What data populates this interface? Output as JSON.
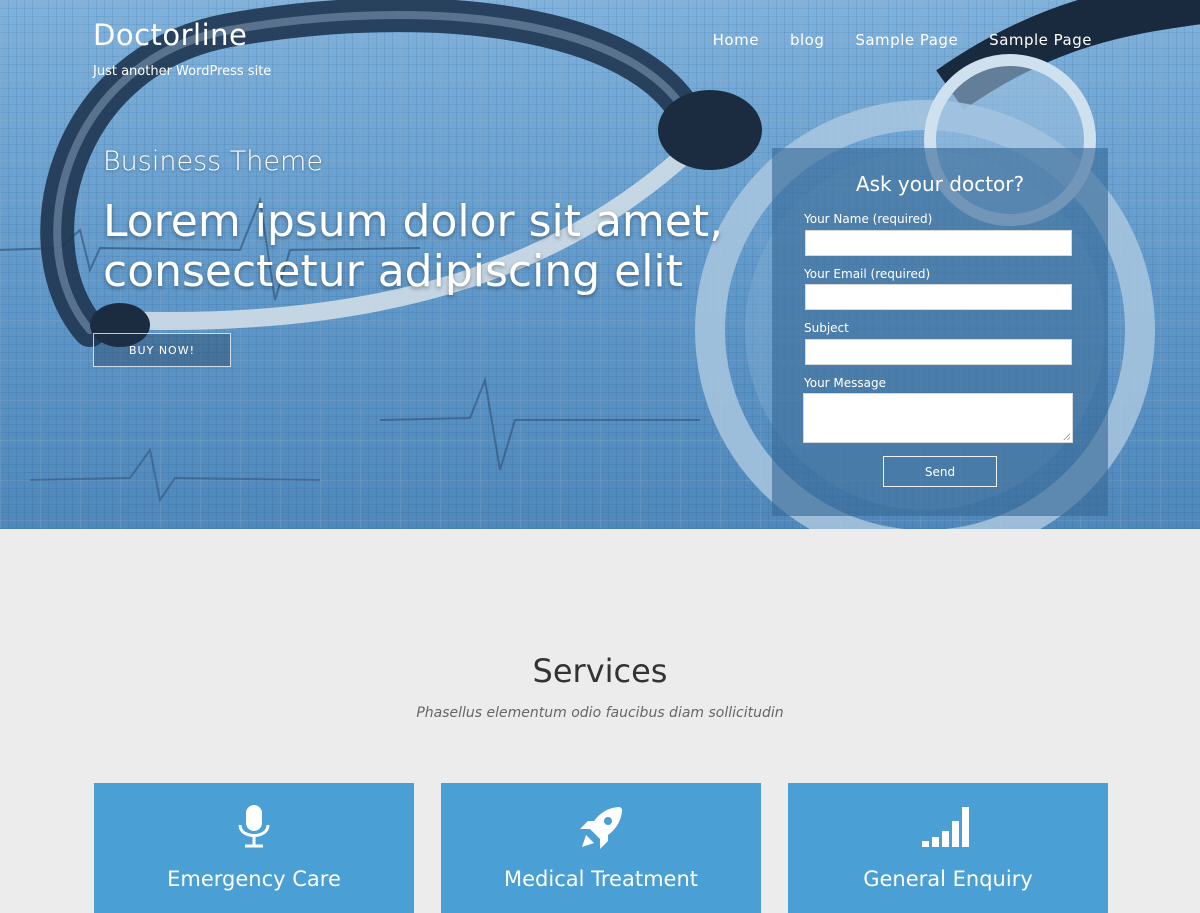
{
  "header": {
    "site_title": "Doctorline",
    "tagline": "Just another WordPress site",
    "nav": [
      "Home",
      "blog",
      "Sample Page",
      "Sample Page"
    ]
  },
  "hero": {
    "eyebrow": "Business Theme",
    "headline": "Lorem ipsum dolor sit amet, consectetur adipiscing elit",
    "cta_label": "BUY NOW!"
  },
  "contact_form": {
    "title": "Ask your doctor?",
    "fields": {
      "name_label": "Your Name (required)",
      "email_label": "Your Email (required)",
      "subject_label": "Subject",
      "message_label": "Your Message",
      "name_value": "",
      "email_value": "",
      "subject_value": "",
      "message_value": ""
    },
    "send_label": "Send"
  },
  "services": {
    "title": "Services",
    "subtitle": "Phasellus elementum odio faucibus diam sollicitudin",
    "cards": [
      {
        "title": "Emergency Care",
        "icon": "microphone-icon"
      },
      {
        "title": "Medical Treatment",
        "icon": "rocket-icon"
      },
      {
        "title": "General Enquiry",
        "icon": "signal-bars-icon"
      }
    ]
  },
  "colors": {
    "hero_blue": "#5f98c9",
    "card_blue": "#4a9fd4",
    "page_bg": "#ececec"
  }
}
